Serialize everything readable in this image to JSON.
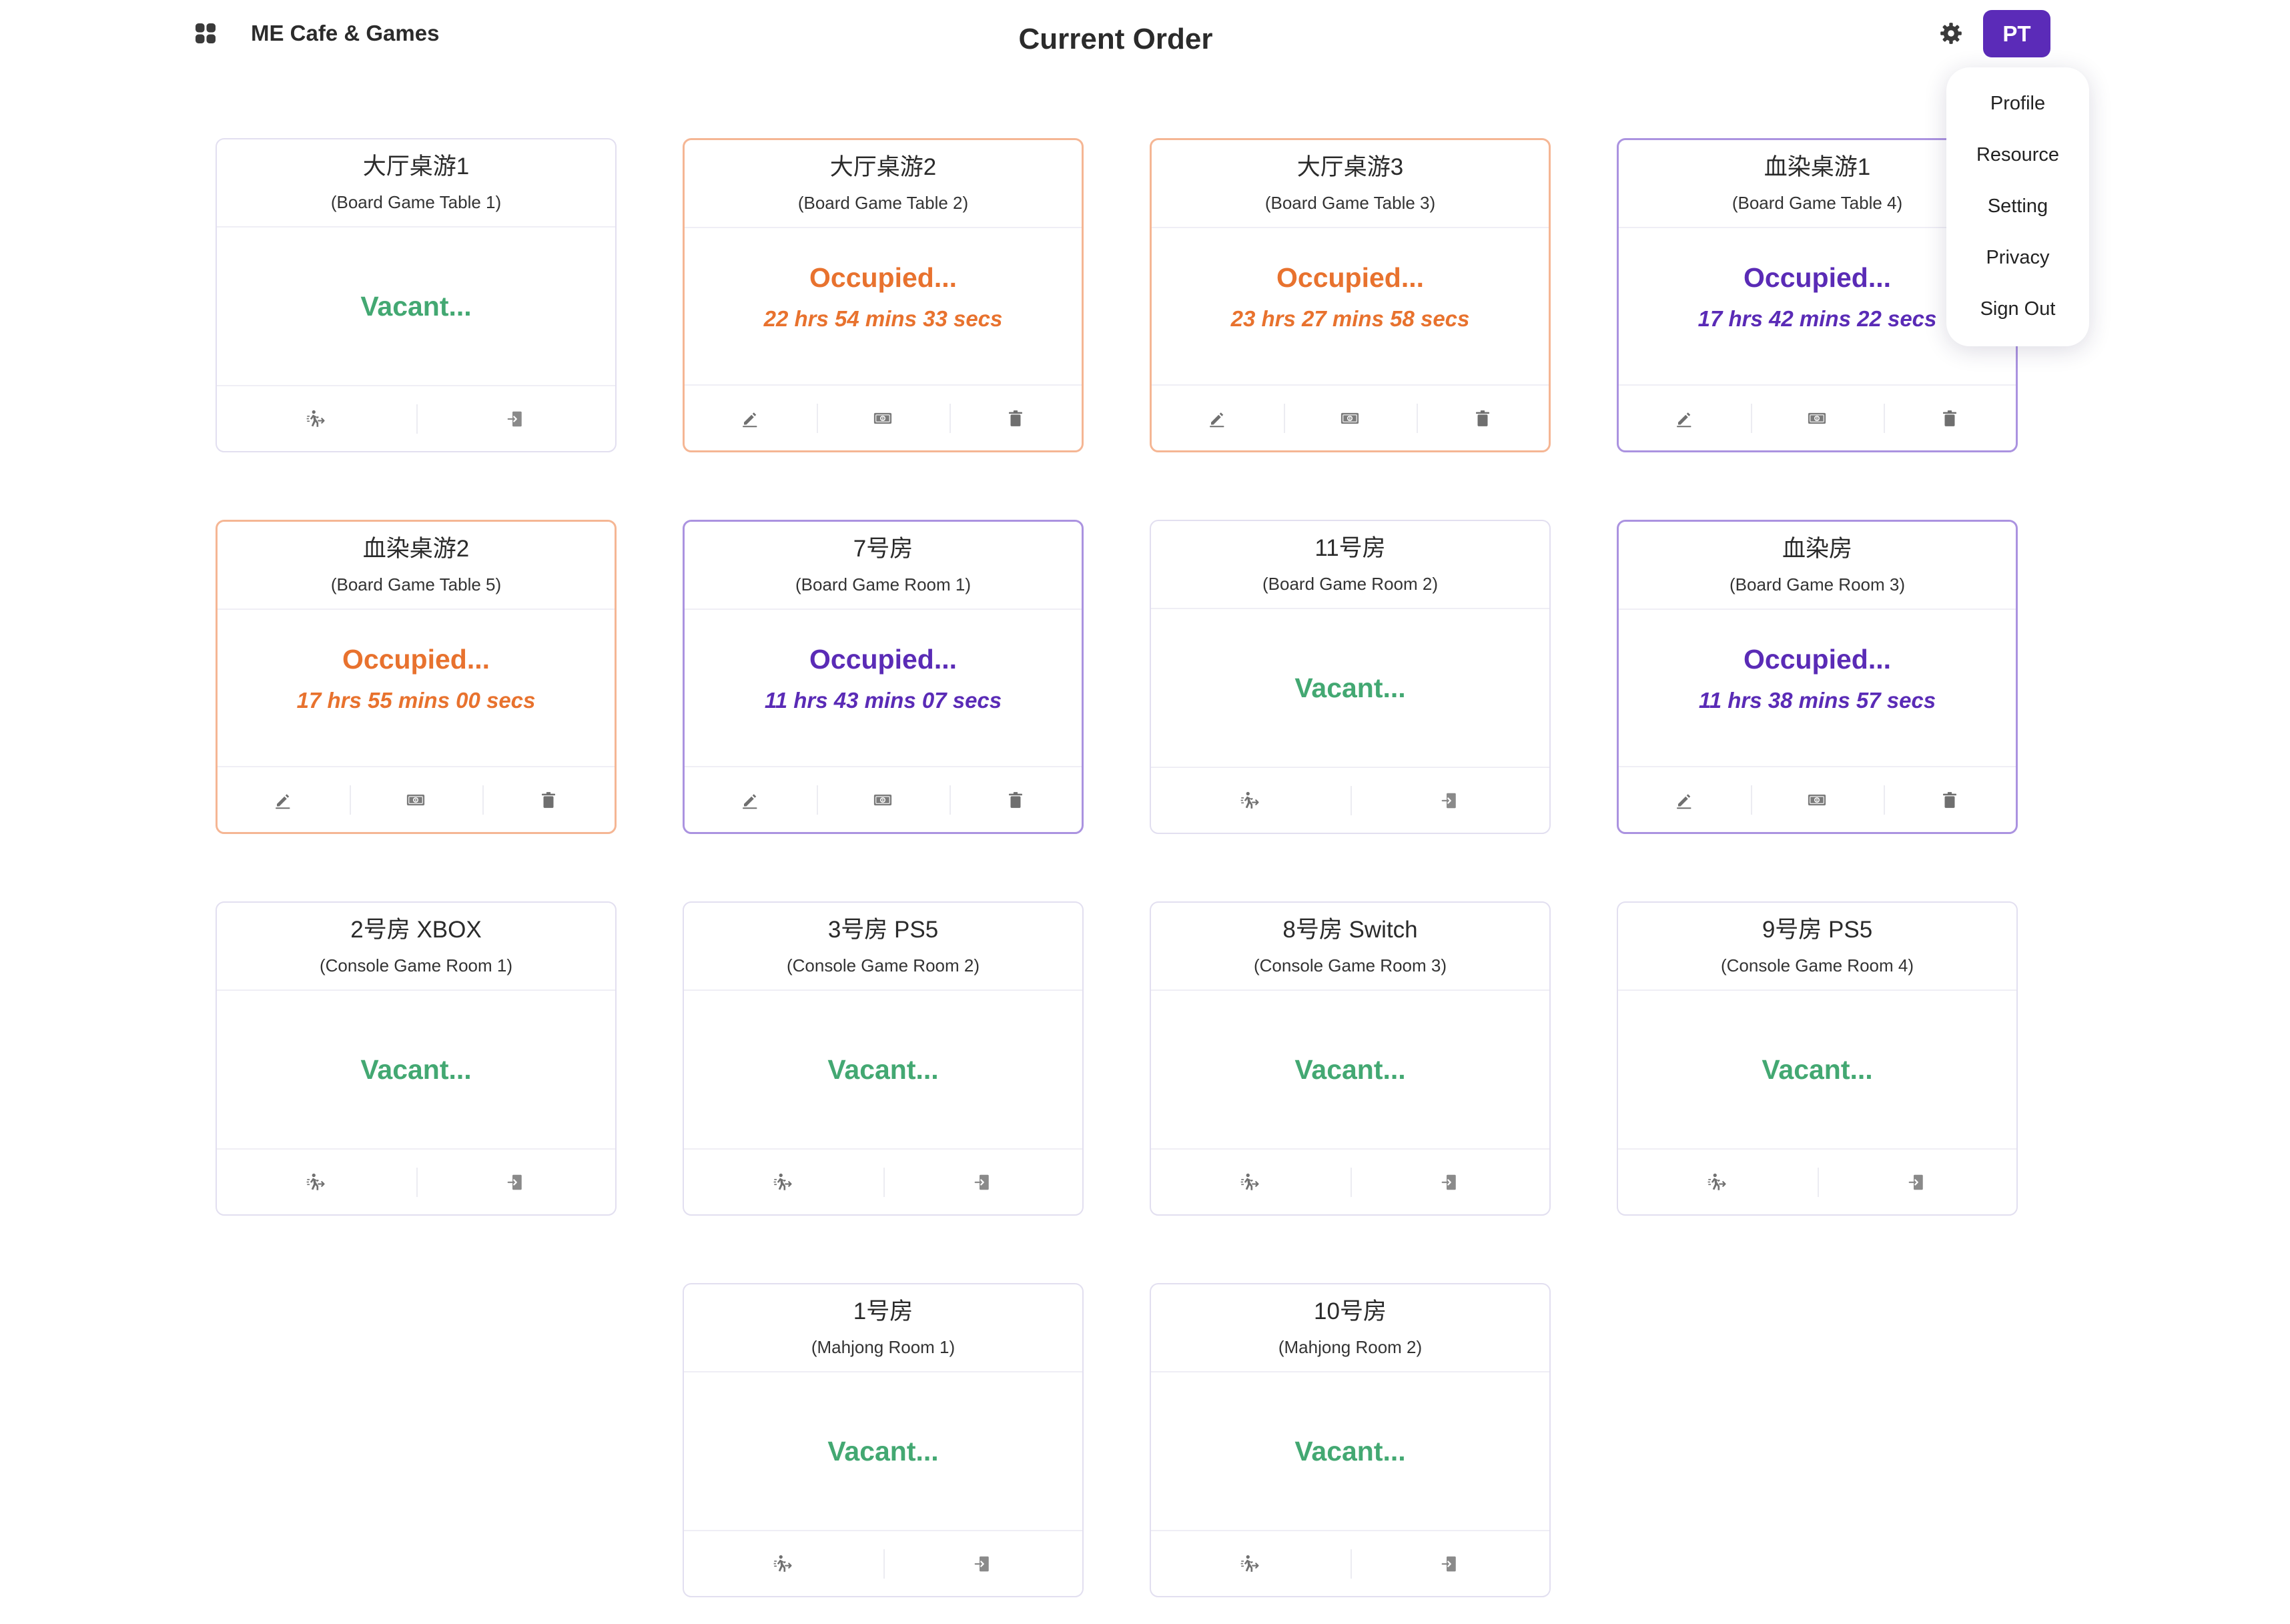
{
  "header": {
    "app_title": "ME Cafe & Games",
    "page_title": "Current Order",
    "avatar_initials": "PT",
    "menu_icon": "grid-icon",
    "settings_icon": "gear-icon"
  },
  "user_menu": {
    "items": [
      "Profile",
      "Resource",
      "Setting",
      "Privacy",
      "Sign Out"
    ]
  },
  "colors": {
    "brand": "#5b2bb8",
    "vacant_text": "#43a872",
    "occupied_orange": "#e8722e",
    "occupied_purple": "#5a2bb6",
    "border_vacant": "#e2dff0",
    "border_orange": "#f5b694",
    "border_purple": "#ab93e0"
  },
  "cards": [
    {
      "name": "大厅桌游1",
      "subtitle": "(Board Game Table 1)",
      "status": "Vacant...",
      "color": "#43a872",
      "border": "#e2dff0",
      "actions": [
        "walk-in-icon",
        "check-in-icon"
      ]
    },
    {
      "name": "大厅桌游2",
      "subtitle": "(Board Game Table 2)",
      "status": "Occupied...",
      "elapsed": "22 hrs 54 mins 33 secs",
      "color": "#e8722e",
      "border": "#f5b694",
      "actions": [
        "edit-icon",
        "payment-icon",
        "delete-icon"
      ]
    },
    {
      "name": "大厅桌游3",
      "subtitle": "(Board Game Table 3)",
      "status": "Occupied...",
      "elapsed": "23 hrs 27 mins 58 secs",
      "color": "#e8722e",
      "border": "#f5b694",
      "actions": [
        "edit-icon",
        "payment-icon",
        "delete-icon"
      ]
    },
    {
      "name": "血染桌游1",
      "subtitle": "(Board Game Table 4)",
      "status": "Occupied...",
      "elapsed": "17 hrs 42 mins 22 secs",
      "color": "#5a2bb6",
      "border": "#ab93e0",
      "actions": [
        "edit-icon",
        "payment-icon",
        "delete-icon"
      ]
    },
    {
      "name": "血染桌游2",
      "subtitle": "(Board Game Table 5)",
      "status": "Occupied...",
      "elapsed": "17 hrs 55 mins 00 secs",
      "color": "#e8722e",
      "border": "#f5b694",
      "actions": [
        "edit-icon",
        "payment-icon",
        "delete-icon"
      ]
    },
    {
      "name": "7号房",
      "subtitle": "(Board Game Room 1)",
      "status": "Occupied...",
      "elapsed": "11 hrs 43 mins 07 secs",
      "color": "#5a2bb6",
      "border": "#ab93e0",
      "actions": [
        "edit-icon",
        "payment-icon",
        "delete-icon"
      ]
    },
    {
      "name": "11号房",
      "subtitle": "(Board Game Room 2)",
      "status": "Vacant...",
      "color": "#43a872",
      "border": "#e2dff0",
      "actions": [
        "walk-in-icon",
        "check-in-icon"
      ]
    },
    {
      "name": "血染房",
      "subtitle": "(Board Game Room 3)",
      "status": "Occupied...",
      "elapsed": "11 hrs 38 mins 57 secs",
      "color": "#5a2bb6",
      "border": "#ab93e0",
      "actions": [
        "edit-icon",
        "payment-icon",
        "delete-icon"
      ]
    },
    {
      "name": "2号房 XBOX",
      "subtitle": "(Console Game Room 1)",
      "status": "Vacant...",
      "color": "#43a872",
      "border": "#e2dff0",
      "actions": [
        "walk-in-icon",
        "check-in-icon"
      ]
    },
    {
      "name": "3号房 PS5",
      "subtitle": "(Console Game Room 2)",
      "status": "Vacant...",
      "color": "#43a872",
      "border": "#e2dff0",
      "actions": [
        "walk-in-icon",
        "check-in-icon"
      ]
    },
    {
      "name": "8号房 Switch",
      "subtitle": "(Console Game Room 3)",
      "status": "Vacant...",
      "color": "#43a872",
      "border": "#e2dff0",
      "actions": [
        "walk-in-icon",
        "check-in-icon"
      ]
    },
    {
      "name": "9号房 PS5",
      "subtitle": "(Console Game Room 4)",
      "status": "Vacant...",
      "color": "#43a872",
      "border": "#e2dff0",
      "actions": [
        "walk-in-icon",
        "check-in-icon"
      ]
    },
    {
      "name": "1号房",
      "subtitle": "(Mahjong Room 1)",
      "status": "Vacant...",
      "color": "#43a872",
      "border": "#e2dff0",
      "actions": [
        "walk-in-icon",
        "check-in-icon"
      ]
    },
    {
      "name": "10号房",
      "subtitle": "(Mahjong Room 2)",
      "status": "Vacant...",
      "color": "#43a872",
      "border": "#e2dff0",
      "actions": [
        "walk-in-icon",
        "check-in-icon"
      ]
    }
  ]
}
